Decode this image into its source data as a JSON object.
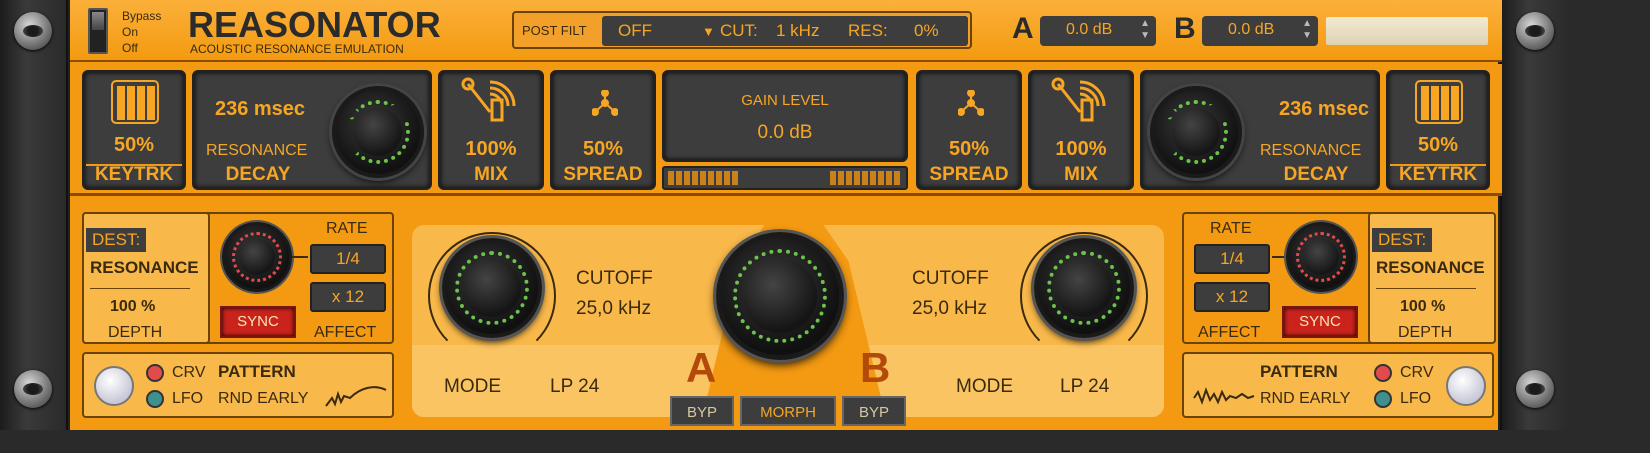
{
  "header": {
    "bypass": [
      "Bypass",
      "On",
      "Off"
    ],
    "title": "REASONATOR",
    "subtitle": "ACOUSTIC RESONANCE EMULATION",
    "post_filt": {
      "label": "POST FILT",
      "mode": "OFF",
      "cut_label": "CUT:",
      "cut_value": "1 kHz",
      "res_label": "RES:",
      "res_value": "0%"
    },
    "a": {
      "label": "A",
      "value": "0.0 dB"
    },
    "b": {
      "label": "B",
      "value": "0.0 dB"
    }
  },
  "left": {
    "keytrk": {
      "value": "50%",
      "label": "KEYTRK"
    },
    "decay": {
      "time": "236 msec",
      "sublabel": "RESONANCE",
      "label": "DECAY"
    },
    "mix": {
      "value": "100%",
      "label": "MIX"
    },
    "spread": {
      "value": "50%",
      "label": "SPREAD"
    }
  },
  "gain": {
    "label": "GAIN LEVEL",
    "value": "0.0 dB"
  },
  "right": {
    "spread": {
      "value": "50%",
      "label": "SPREAD"
    },
    "mix": {
      "value": "100%",
      "label": "MIX"
    },
    "decay": {
      "time": "236 msec",
      "sublabel": "RESONANCE",
      "label": "DECAY"
    },
    "keytrk": {
      "value": "50%",
      "label": "KEYTRK"
    }
  },
  "lfo_left": {
    "dest_label": "DEST:",
    "dest_value": "RESONANCE",
    "depth_value": "100 %",
    "depth_label": "DEPTH",
    "rate_label": "RATE",
    "rate_value": "1/4",
    "multiplier": "x 12",
    "sync": "SYNC",
    "affect": "AFFECT",
    "crv": "CRV",
    "lfo": "LFO",
    "pattern_label": "PATTERN",
    "pattern_value": "RND EARLY"
  },
  "lfo_right": {
    "dest_label": "DEST:",
    "dest_value": "RESONANCE",
    "depth_value": "100 %",
    "depth_label": "DEPTH",
    "rate_label": "RATE",
    "rate_value": "1/4",
    "multiplier": "x 12",
    "sync": "SYNC",
    "affect": "AFFECT",
    "crv": "CRV",
    "lfo": "LFO",
    "pattern_label": "PATTERN",
    "pattern_value": "RND EARLY"
  },
  "filter_a": {
    "cutoff_label": "CUTOFF",
    "cutoff_value": "25,0 kHz",
    "mode_label": "MODE",
    "mode_value": "LP 24",
    "letter": "A"
  },
  "filter_b": {
    "cutoff_label": "CUTOFF",
    "cutoff_value": "25,0 kHz",
    "mode_label": "MODE",
    "mode_value": "LP 24",
    "letter": "B"
  },
  "morph": {
    "byp_a": "BYP",
    "morph": "MORPH",
    "byp_b": "BYP"
  },
  "colors": {
    "panel": "#f49a12",
    "lcd": "#3d3d3d",
    "lcd_text": "#f7a623",
    "sync": "#c9231c",
    "led_green": "#6cc24a"
  }
}
